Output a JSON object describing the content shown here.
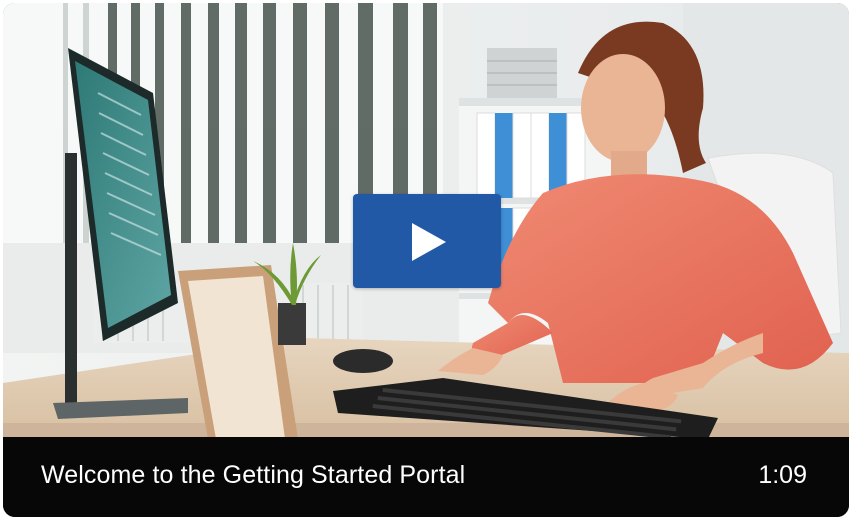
{
  "video": {
    "title": "Welcome to the Getting Started Portal",
    "duration": "1:09",
    "thumbnail_description_icon": "video-thumbnail",
    "play_icon": "play-icon"
  },
  "colors": {
    "play_button": "#2159a7",
    "caption_bar": "#070707",
    "caption_text": "#ffffff"
  }
}
